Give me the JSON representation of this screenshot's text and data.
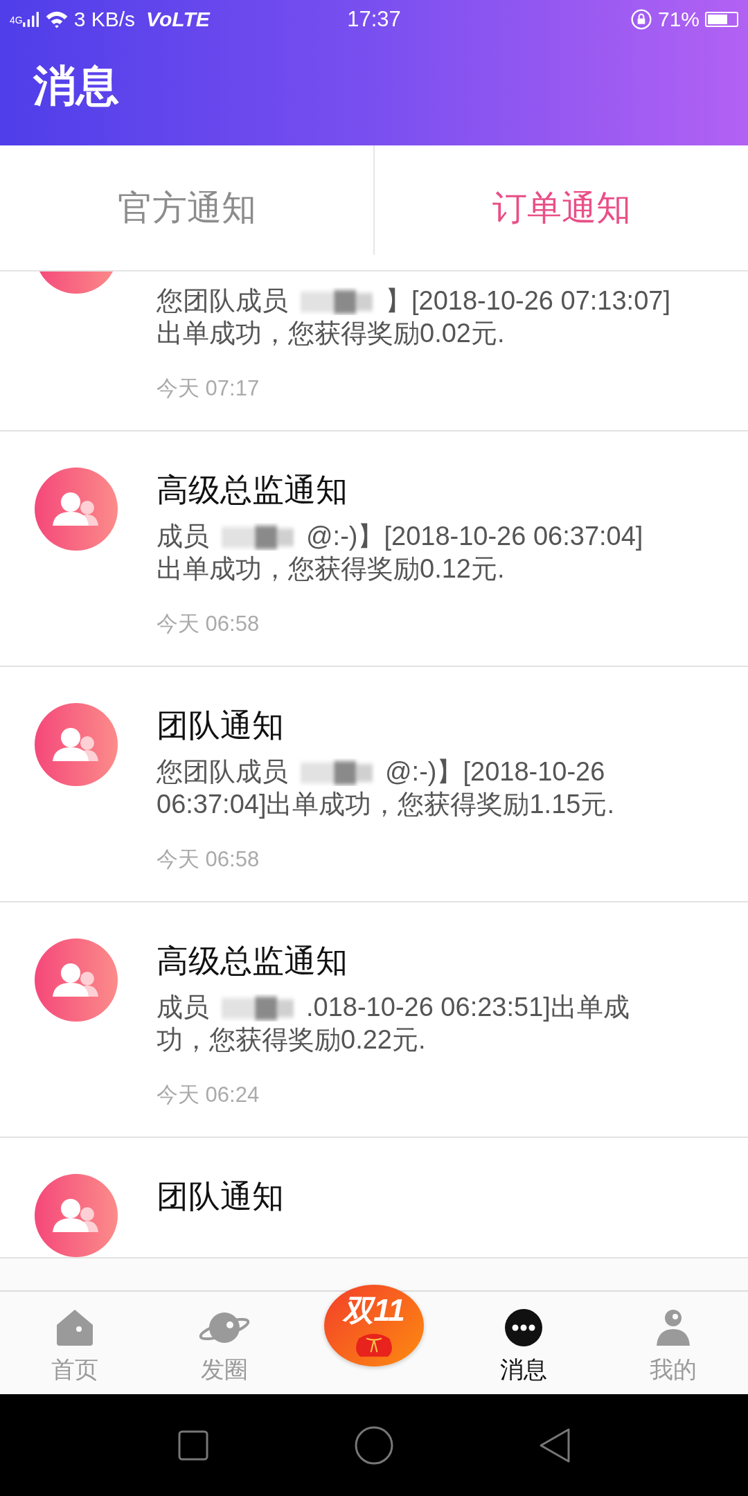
{
  "status_bar": {
    "network": "4G",
    "speed": "3 KB/s",
    "volte": "VoLTE",
    "time": "17:37",
    "battery": "71%"
  },
  "header": {
    "title": "消息"
  },
  "tabs": [
    {
      "label": "官方通知",
      "selected": false
    },
    {
      "label": "订单通知",
      "selected": true
    }
  ],
  "messages": [
    {
      "body_before": "您团队成员",
      "body_after": "】[2018-10-26 07:13:07]",
      "body_line2": "出单成功，您获得奖励0.02元.",
      "time": "今天 07:17"
    },
    {
      "title": "高级总监通知",
      "body_before": "成员",
      "body_after": "@:-)】[2018-10-26 06:37:04]",
      "body_line2": "出单成功，您获得奖励0.12元.",
      "time": "今天 06:58"
    },
    {
      "title": "团队通知",
      "body_before": "您团队成员",
      "body_after": "@:-)】[2018-10-26",
      "body_line2": "06:37:04]出单成功，您获得奖励1.15元.",
      "time": "今天 06:58"
    },
    {
      "title": "高级总监通知",
      "body_before": "成员",
      "body_after": ".018-10-26 06:23:51]出单成",
      "body_line2": "功，您获得奖励0.22元.",
      "time": "今天 06:24"
    },
    {
      "title": "团队通知"
    }
  ],
  "bottom_nav": [
    {
      "kind": "home",
      "label": "首页",
      "selected": false
    },
    {
      "kind": "planet",
      "label": "发圈",
      "selected": false
    },
    {
      "kind": "promo",
      "label": "双11"
    },
    {
      "kind": "chat",
      "label": "消息",
      "selected": true
    },
    {
      "kind": "person",
      "label": "我的",
      "selected": false
    }
  ]
}
